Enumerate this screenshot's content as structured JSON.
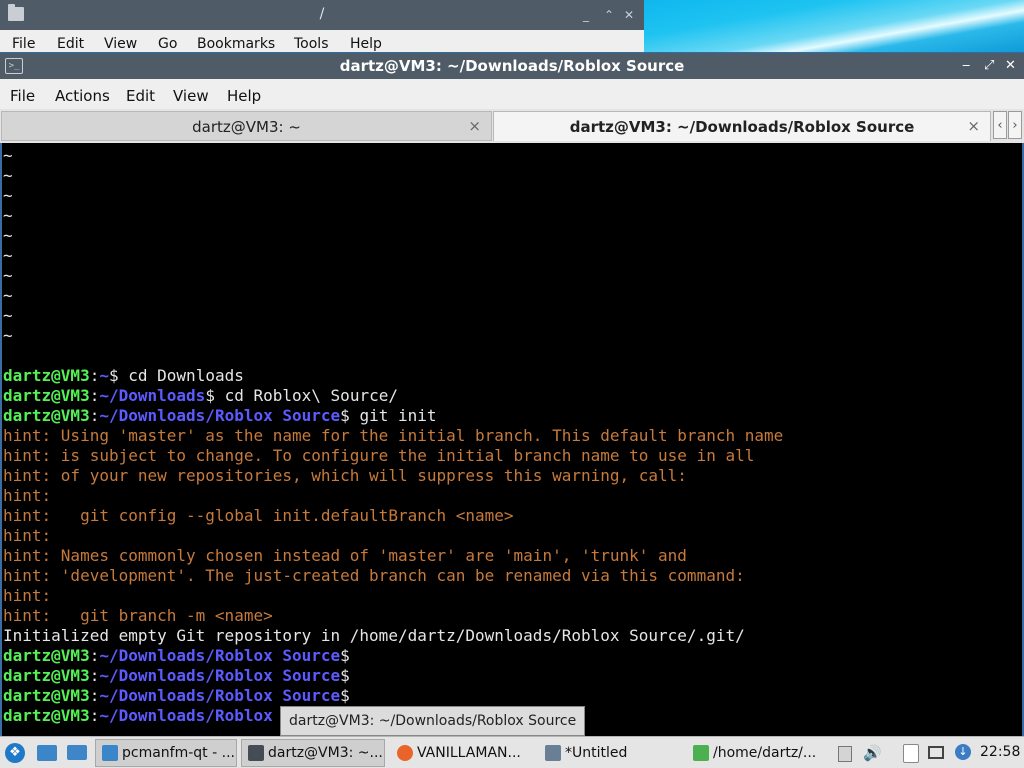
{
  "bg_window": {
    "title": "/",
    "controls": [
      "_",
      "⌃",
      "✕"
    ],
    "menu": [
      "File",
      "Edit",
      "View",
      "Go",
      "Bookmarks",
      "Tools",
      "Help"
    ]
  },
  "terminal": {
    "title": "dartz@VM3: ~/Downloads/Roblox Source",
    "controls": [
      "‒",
      "⤢",
      "✕"
    ],
    "menu": [
      "File",
      "Actions",
      "Edit",
      "View",
      "Help"
    ],
    "tabs": [
      {
        "label": "dartz@VM3: ~",
        "close": "×"
      },
      {
        "label": "dartz@VM3: ~/Downloads/Roblox Source",
        "close": "×"
      }
    ],
    "tab_scroll": {
      "left": "‹",
      "right": "›"
    },
    "tildes": [
      "~",
      "~",
      "~",
      "~",
      "~",
      "~",
      "~",
      "~",
      "~",
      "~"
    ],
    "blank_line": "",
    "lines": [
      {
        "kind": "prompt",
        "user": "dartz@VM3",
        "sep": ":",
        "path": "~",
        "sign": "$",
        "cmd": " cd Downloads"
      },
      {
        "kind": "prompt",
        "user": "dartz@VM3",
        "sep": ":",
        "path": "~/Downloads",
        "sign": "$",
        "cmd": " cd Roblox\\ Source/"
      },
      {
        "kind": "prompt",
        "user": "dartz@VM3",
        "sep": ":",
        "path": "~/Downloads/Roblox Source",
        "sign": "$",
        "cmd": " git init"
      },
      {
        "kind": "hint",
        "text": "hint: Using 'master' as the name for the initial branch. This default branch name"
      },
      {
        "kind": "hint",
        "text": "hint: is subject to change. To configure the initial branch name to use in all"
      },
      {
        "kind": "hint",
        "text": "hint: of your new repositories, which will suppress this warning, call:"
      },
      {
        "kind": "hint",
        "text": "hint:"
      },
      {
        "kind": "hint",
        "text": "hint:   git config --global init.defaultBranch <name>"
      },
      {
        "kind": "hint",
        "text": "hint:"
      },
      {
        "kind": "hint",
        "text": "hint: Names commonly chosen instead of 'master' are 'main', 'trunk' and"
      },
      {
        "kind": "hint",
        "text": "hint: 'development'. The just-created branch can be renamed via this command:"
      },
      {
        "kind": "hint",
        "text": "hint:"
      },
      {
        "kind": "hint",
        "text": "hint:   git branch -m <name>"
      },
      {
        "kind": "out",
        "text": "Initialized empty Git repository in /home/dartz/Downloads/Roblox Source/.git/"
      },
      {
        "kind": "prompt",
        "user": "dartz@VM3",
        "sep": ":",
        "path": "~/Downloads/Roblox Source",
        "sign": "$",
        "cmd": ""
      },
      {
        "kind": "prompt",
        "user": "dartz@VM3",
        "sep": ":",
        "path": "~/Downloads/Roblox Source",
        "sign": "$",
        "cmd": ""
      },
      {
        "kind": "prompt",
        "user": "dartz@VM3",
        "sep": ":",
        "path": "~/Downloads/Roblox Source",
        "sign": "$",
        "cmd": ""
      },
      {
        "kind": "prompt",
        "user": "dartz@VM3",
        "sep": ":",
        "path": "~/Downloads/Roblox",
        "sign": "",
        "cmd": ""
      }
    ]
  },
  "tooltip": "dartz@VM3: ~/Downloads/Roblox Source",
  "taskbar": {
    "tasks": [
      {
        "label": "pcmanfm-qt - ...",
        "icon": "file-manager-icon",
        "color": "#3a86c8",
        "active": true
      },
      {
        "label": "dartz@VM3: ~...",
        "icon": "terminal-icon",
        "color": "#444c55",
        "active": true
      },
      {
        "label": "VANILLAMAN...",
        "icon": "firefox-icon",
        "color": "#e8642a",
        "active": false
      },
      {
        "label": "*Untitled",
        "icon": "text-editor-icon",
        "color": "#6b7f94",
        "active": false
      },
      {
        "label": "/home/dartz/...",
        "icon": "file-manager-icon",
        "color": "#4caf50",
        "active": false
      }
    ],
    "start_glyph": "❖",
    "update_glyph": "↓",
    "volume_glyph": "🔊",
    "clock": "22:58"
  }
}
